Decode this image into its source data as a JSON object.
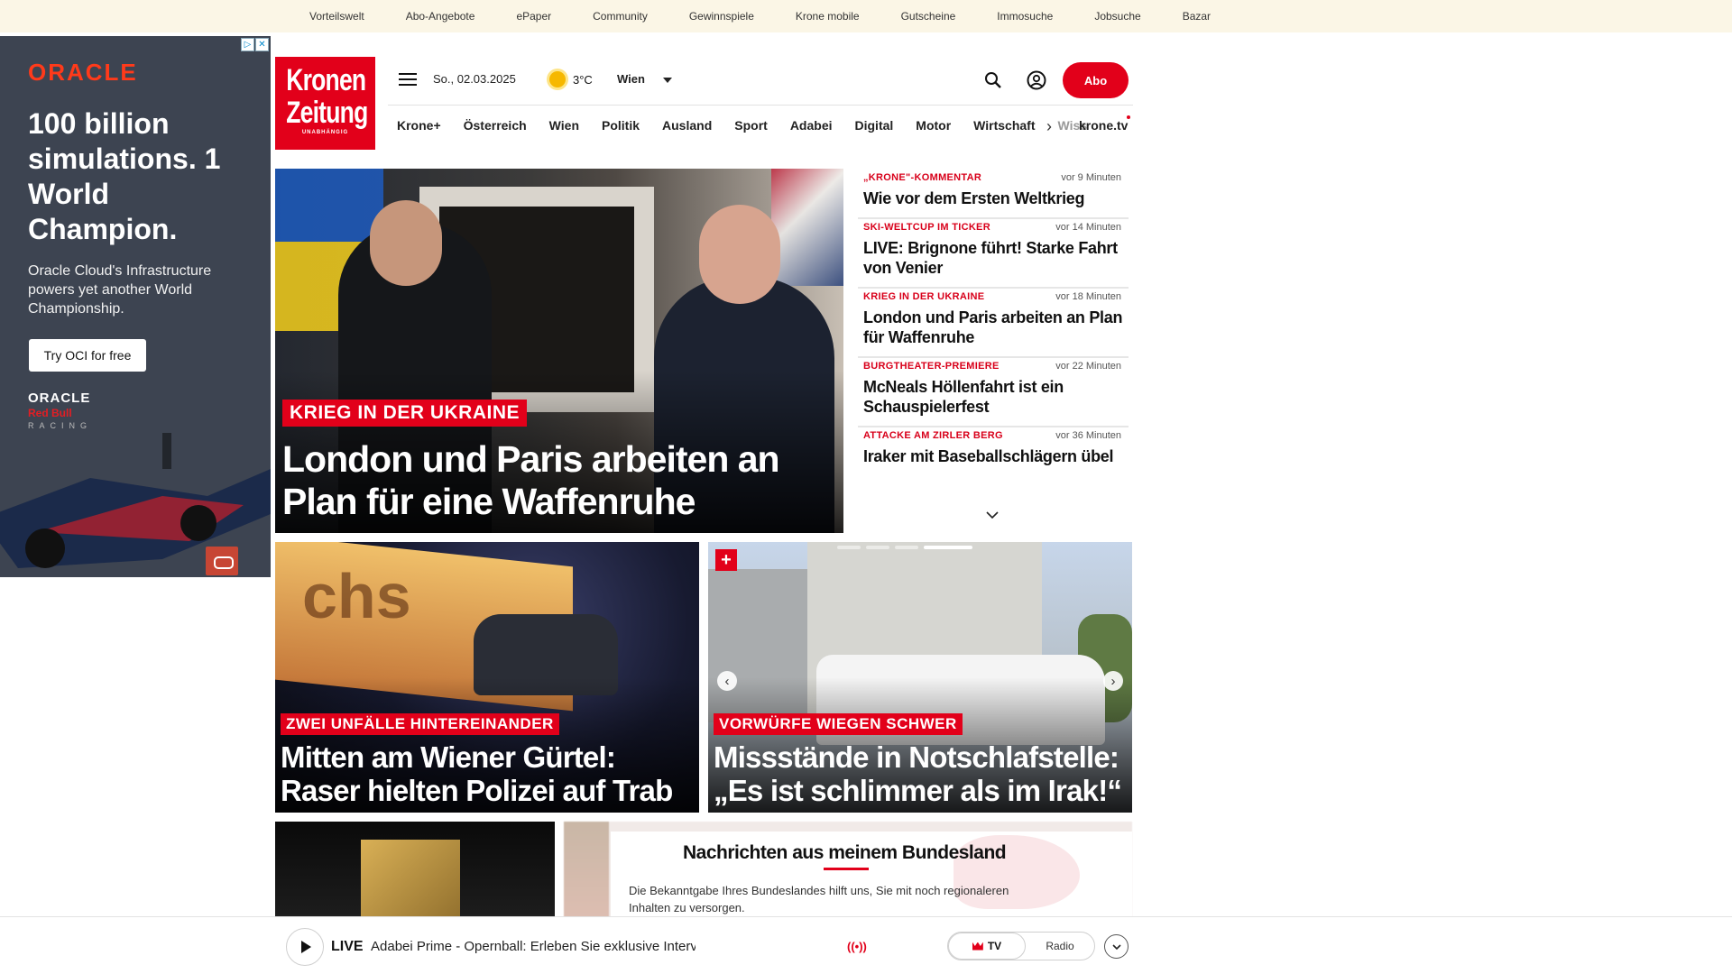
{
  "topbar": {
    "links": [
      "Vorteilswelt",
      "Abo-Angebote",
      "ePaper",
      "Community",
      "Gewinnspiele",
      "Krone mobile",
      "Gutscheine",
      "Immosuche",
      "Jobsuche",
      "Bazar"
    ]
  },
  "ad": {
    "logo": "ORACLE",
    "headline": "100 billion simulations. 1 World Champion.",
    "sub": "Oracle Cloud's Infrastructure powers yet another World Championship.",
    "cta": "Try OCI for free",
    "brand_line1": "ORACLE",
    "brand_line2": "Red Bull",
    "brand_line3": "RACING"
  },
  "header": {
    "logo_line1": "Kronen",
    "logo_line2": "Zeitung",
    "logo_tagline": "UNABHÄNGIG",
    "date": "So., 02.03.2025",
    "temperature": "3°C",
    "city": "Wien",
    "abo_label": "Abo"
  },
  "nav": {
    "items": [
      "Krone+",
      "Österreich",
      "Wien",
      "Politik",
      "Ausland",
      "Sport",
      "Adabei",
      "Digital",
      "Motor",
      "Wirtschaft"
    ],
    "faded": "Wiss",
    "tv": "krone.tv"
  },
  "hero": {
    "kicker": "KRIEG IN DER UKRAINE",
    "title": "London und Paris arbeiten an Plan für eine Waffenruhe"
  },
  "ticker": [
    {
      "kicker": "„KRONE\"-KOMMENTAR",
      "time": "vor 9 Minuten",
      "title": "Wie vor dem Ersten Weltkrieg"
    },
    {
      "kicker": "SKI-WELTCUP IM TICKER",
      "time": "vor 14 Minuten",
      "title": "LIVE: Brignone führt! Starke Fahrt von Venier"
    },
    {
      "kicker": "KRIEG IN DER UKRAINE",
      "time": "vor 18 Minuten",
      "title": "London und Paris arbeiten an Plan für Waffenruhe"
    },
    {
      "kicker": "BURGTHEATER-PREMIERE",
      "time": "vor 22 Minuten",
      "title": "McNeals Höllenfahrt ist ein Schauspielerfest"
    },
    {
      "kicker": "ATTACKE AM ZIRLER BERG",
      "time": "vor 36 Minuten",
      "title": "Iraker mit Baseballschlägern übel"
    }
  ],
  "teasers": [
    {
      "kicker": "ZWEI UNFÄLLE HINTEREINANDER",
      "title": "Mitten am Wiener Gürtel: Raser hielten Polizei auf Trab",
      "image_text": "chs"
    },
    {
      "kicker": "VORWÜRFE WIEGEN SCHWER",
      "title": "Missstände in Notschlafstelle: „Es ist schlimmer als im Irak!“",
      "badge": "+"
    }
  ],
  "bundesland": {
    "title": "Nachrichten aus meinem Bundesland",
    "text": "Die Bekanntgabe Ihres Bundeslandes hilft uns, Sie mit noch regionaleren Inhalten zu versorgen."
  },
  "player": {
    "live_label": "LIVE",
    "text": "Adabei Prime - Opernball: Erleben Sie exklusive Interviews, spannende Ei...",
    "live_icon": "((•))",
    "tv_label": "TV",
    "radio_label": "Radio"
  },
  "colors": {
    "brand_red": "#e2001a",
    "topbar_bg": "#fbf6e6",
    "ad_bg": "#3d4451"
  }
}
